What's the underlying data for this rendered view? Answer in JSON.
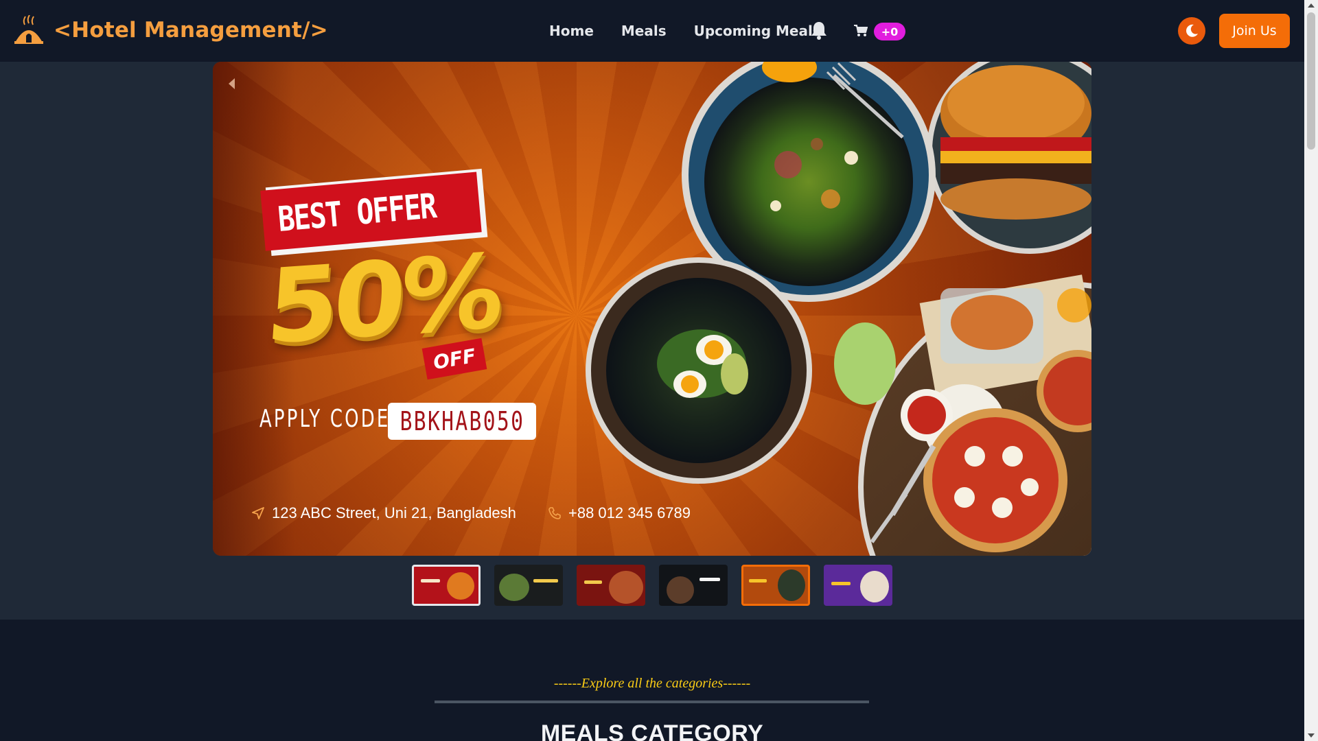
{
  "brand": {
    "name": "<Hotel Management/>"
  },
  "nav": {
    "links": [
      "Home",
      "Meals",
      "Upcoming Meals"
    ],
    "cart_count": "+0",
    "join_label": "Join Us"
  },
  "banner": {
    "headline": "BEST OFFER",
    "discount": "50%",
    "off": "OFF",
    "apply_label": "APPLY CODE",
    "code": "BBKHAB050",
    "address": "123 ABC Street, Uni 21, Bangladesh",
    "phone": "+88 012 345 6789"
  },
  "carousel": {
    "thumbnail_count": 6,
    "selected_index": 4
  },
  "section": {
    "tagline": "------Explore all the categories------",
    "title": "MEALS CATEGORY"
  },
  "colors": {
    "accent": "#f46d08",
    "brand_text": "#f59e3f",
    "badge": "#e11dde",
    "navbar_bg": "#111827",
    "hero_bg": "#1f2937",
    "tagline": "#facc15"
  },
  "icons": [
    "hotel-logo-icon",
    "bell-icon",
    "cart-icon",
    "moon-icon",
    "prev-arrow-icon",
    "location-arrow-icon",
    "phone-icon"
  ]
}
